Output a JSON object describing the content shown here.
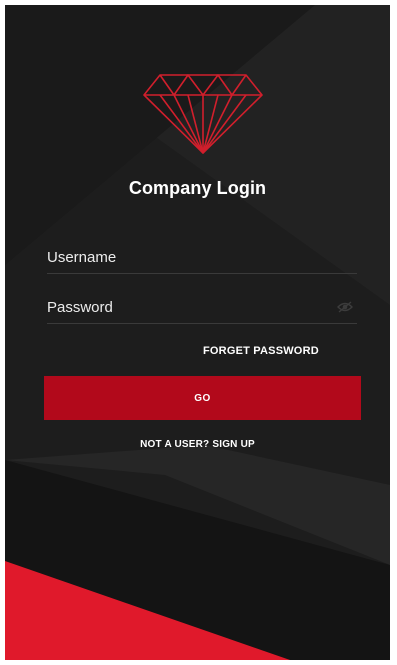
{
  "app": {
    "title": "Company Login"
  },
  "form": {
    "username_placeholder": "Username",
    "password_placeholder": "Password",
    "forget_password_label": "FORGET PASSWORD",
    "go_label": "GO",
    "signup_label": "NOT A USER? SIGN UP"
  },
  "icons": {
    "logo": "diamond-icon",
    "password_toggle": "eye-icon"
  },
  "colors": {
    "background": "#1f1f1f",
    "accent": "#b2091b",
    "accent_bright": "#e0192b",
    "text": "#ffffff"
  }
}
